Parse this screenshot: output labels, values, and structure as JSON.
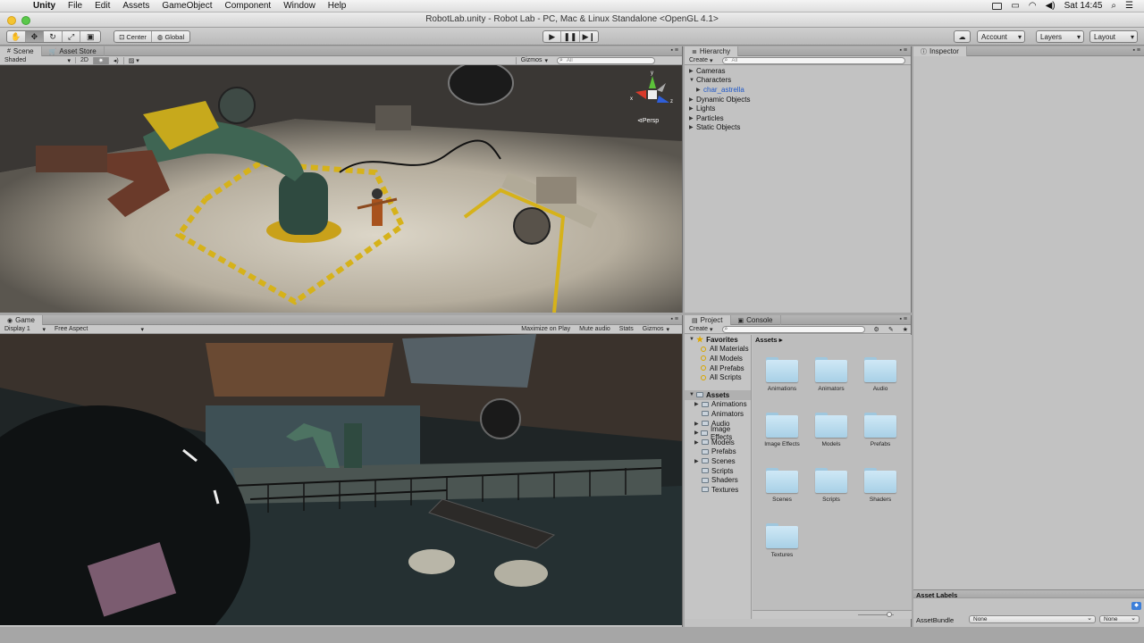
{
  "menubar": {
    "app": "Unity",
    "items": [
      "File",
      "Edit",
      "Assets",
      "GameObject",
      "Component",
      "Window",
      "Help"
    ],
    "clock": "Sat 14:45"
  },
  "window": {
    "title": "RobotLab.unity - Robot Lab - PC, Mac & Linux Standalone <OpenGL 4.1>"
  },
  "toolbar": {
    "pivot": "Center",
    "space": "Global",
    "account": "Account",
    "layers": "Layers",
    "layout": "Layout"
  },
  "scene": {
    "tabs": [
      "Scene",
      "Asset Store"
    ],
    "shading": "Shaded",
    "mode2d": "2D",
    "gizmos": "Gizmos",
    "search_placeholder": "All",
    "persp": "Persp",
    "axis_y": "y",
    "axis_x": "x",
    "axis_z": "z"
  },
  "game": {
    "tab": "Game",
    "display": "Display 1",
    "aspect": "Free Aspect",
    "maximize": "Maximize on Play",
    "mute": "Mute audio",
    "stats": "Stats",
    "gizmos": "Gizmos"
  },
  "hierarchy": {
    "tab": "Hierarchy",
    "create": "Create",
    "search_placeholder": "All",
    "items": [
      "Cameras",
      "Characters",
      "char_astrella",
      "Dynamic Objects",
      "Lights",
      "Particles",
      "Static Objects"
    ]
  },
  "inspector": {
    "tab": "Inspector"
  },
  "project": {
    "tabs": [
      "Project",
      "Console"
    ],
    "create": "Create",
    "favorites_label": "Favorites",
    "favorites": [
      "All Materials",
      "All Models",
      "All Prefabs",
      "All Scripts"
    ],
    "assets_label": "Assets",
    "folders": [
      "Animations",
      "Animators",
      "Audio",
      "Image Effects",
      "Models",
      "Prefabs",
      "Scenes",
      "Scripts",
      "Shaders",
      "Textures"
    ],
    "breadcrumb": "Assets",
    "grid": [
      "Animations",
      "Animators",
      "Audio",
      "Image Effects",
      "Models",
      "Prefabs",
      "Scenes",
      "Scripts",
      "Shaders",
      "Textures"
    ]
  },
  "asset_labels": {
    "title": "Asset Labels",
    "bundle_label": "AssetBundle",
    "bundle_value": "None",
    "variant_value": "None"
  },
  "colors": {
    "selected": "#1e57c8",
    "panel": "#c2c2c2",
    "viewport_border": "#5a5a5a"
  }
}
